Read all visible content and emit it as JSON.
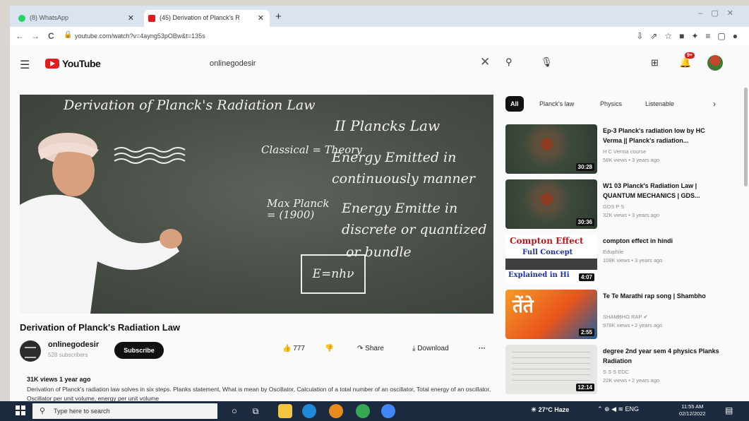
{
  "browser": {
    "tabs": [
      {
        "title": "(8) WhatsApp",
        "active": false
      },
      {
        "title": "(45) Derivation of Planck's R",
        "active": true
      }
    ],
    "url": "youtube.com/watch?v=4ayng53pOBw&t=135s"
  },
  "youtube": {
    "logo_text": "YouTube",
    "search_value": "onlinegodesir",
    "notification_count": "9+"
  },
  "video": {
    "board": {
      "heading": "Derivation of Planck's Radiation Law",
      "section": "II Plancks Law",
      "classical_label": "Classical = Theory",
      "classical_text": "Energy Emitted in continuously manner",
      "planck_label": "Max Planck = (1900)",
      "planck_text": "Energy Emitte in discrete or quantized",
      "bundle_text": "or bundle",
      "equation": "E=nhν"
    },
    "title": "Derivation of Planck's Radiation Law",
    "channel": "onlinegodesir",
    "subscribers": "528 subscribers",
    "subscribe_label": "Subscribe",
    "likes": "777",
    "share_label": "Share",
    "download_label": "Download",
    "views_line": "31K views  1 year ago",
    "description": "Derivation of Planck's radiation law solves in six steps. Planks statement, What is mean by Oscillator, Calculation of a total number of an oscillator, Total energy of an oscillator, Oscillator per unit volume, energy per unit volume"
  },
  "chips": [
    "All",
    "Planck's law",
    "Physics",
    "Listenable"
  ],
  "recommendations": [
    {
      "title": "Ep-3 Planck's radiation low by HC Verma || Planck's radiation...",
      "channel": "H C Verma course",
      "meta": "58K views • 3 years ago",
      "duration": "30:28",
      "thumb": "lecture"
    },
    {
      "title": "W1 03 Planck's Radiation Law | QUANTUM MECHANICS | GDS...",
      "channel": "GDS P S",
      "meta": "32K views • 3 years ago",
      "duration": "30:36",
      "thumb": "lecture"
    },
    {
      "title": "compton effect in hindi",
      "channel": "Eduphile",
      "meta": "108K views • 3 years ago",
      "duration": "4:07",
      "thumb": "compton",
      "thumb_line1": "Compton Effect",
      "thumb_line2": "Full Concept",
      "thumb_line3": "Explained in Hi"
    },
    {
      "title": "Te Te Marathi rap song | Shambho",
      "channel": "SHAMBHO RAP",
      "meta": "978K views • 2 years ago",
      "duration": "2:55",
      "thumb": "rap",
      "thumb_line1": "तेंते"
    },
    {
      "title": "degree 2nd year sem 4 physics Planks Radiation",
      "channel": "S S S EDC",
      "meta": "22K views • 2 years ago",
      "duration": "12:14",
      "thumb": "paper"
    }
  ],
  "taskbar": {
    "search_placeholder": "Type here to search",
    "weather": "27°C Haze",
    "lang": "ENG",
    "time": "11:55 AM",
    "date": "02/12/2022"
  }
}
